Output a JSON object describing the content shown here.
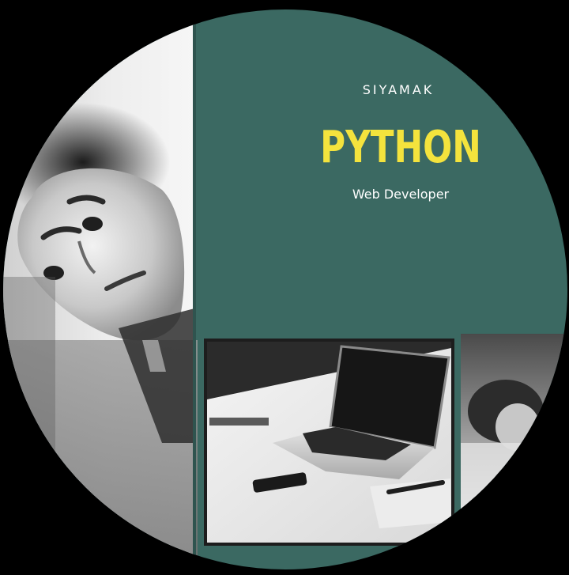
{
  "card": {
    "name": "SIYAMAK",
    "headline": "PYTHON",
    "role": "Web Developer"
  },
  "colors": {
    "background": "#000000",
    "panel": "#3b6962",
    "headline": "#f4e33d",
    "text": "#ffffff"
  }
}
